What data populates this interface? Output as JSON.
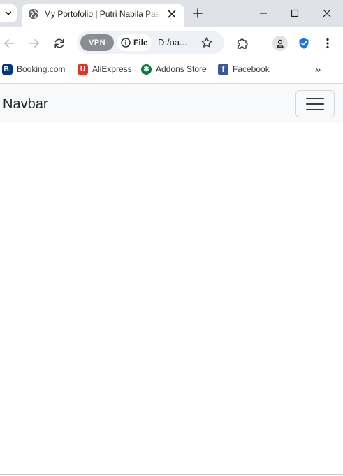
{
  "browser": {
    "active_tab": {
      "title": "My Portofolio | Putri Nabila Pasaribu",
      "favicon": "globe-icon"
    },
    "toolbar": {
      "vpn_label": "VPN",
      "site_info_label": "File",
      "url": "D:/ua..."
    },
    "bookmarks": [
      {
        "label": "Booking.com",
        "icon": "booking-icon",
        "color": "#003580",
        "glyph": "B."
      },
      {
        "label": "AliExpress",
        "icon": "aliexpress-icon",
        "color": "#e43225",
        "glyph": "U"
      },
      {
        "label": "Addons Store",
        "icon": "addons-store-icon",
        "color": "#0b7a3e",
        "glyph": "✱"
      },
      {
        "label": "Facebook",
        "icon": "facebook-icon",
        "color": "#3b5998",
        "glyph": "f"
      }
    ],
    "bookmarks_overflow": "»"
  },
  "page": {
    "navbar": {
      "brand": "Navbar"
    }
  },
  "colors": {
    "tab_strip_bg": "#dfe3e8",
    "navbar_bg": "#f8f9fa",
    "vpn_chip": "#8a8d91",
    "shield_blue": "#1a73e8"
  }
}
